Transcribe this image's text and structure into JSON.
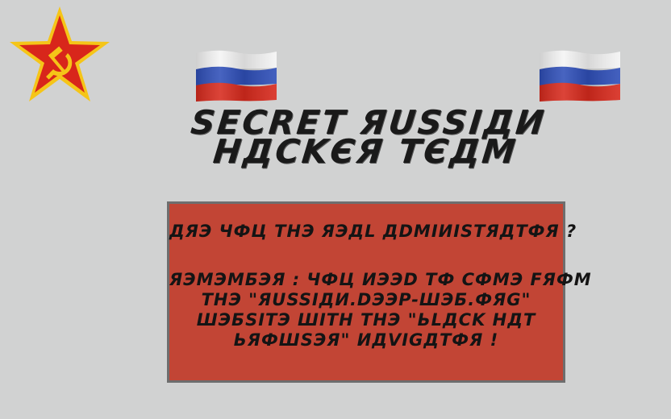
{
  "title": {
    "line1": "SECRET ЯUSSIДИ",
    "line2": "НДCKЄЯ TЄДМ"
  },
  "panel": {
    "question": "ДЯЭ ЧФЦ THЭ ЯЭДL ДDMIИISTЯДTФЯ ?",
    "message_lines": [
      "ЯЭMЭMБЭЯ : ЧФЦ ИЭЭD TФ CФMЭ FЯФM",
      "THЭ \"ЯUSSIДИ.DЭЭP-ШЭБ.ФЯG\"",
      "ШЭБSITЭ ШITH THЭ \"ЬLДCK HДT",
      "ЬЯФШSЭЯ\" ИДVIGДTФЯ !"
    ]
  },
  "icons": {
    "emblem": "soviet-star-emblem",
    "flag": "russian-flag"
  },
  "colors": {
    "background": "#d1d2d2",
    "panel": "#c24535",
    "panel_border": "#6e6e6e",
    "star_red": "#d8261b",
    "star_gold": "#f5c518",
    "flag_white": "#f4f4f4",
    "flag_blue": "#2f4fb8",
    "flag_red": "#d72a1d"
  }
}
